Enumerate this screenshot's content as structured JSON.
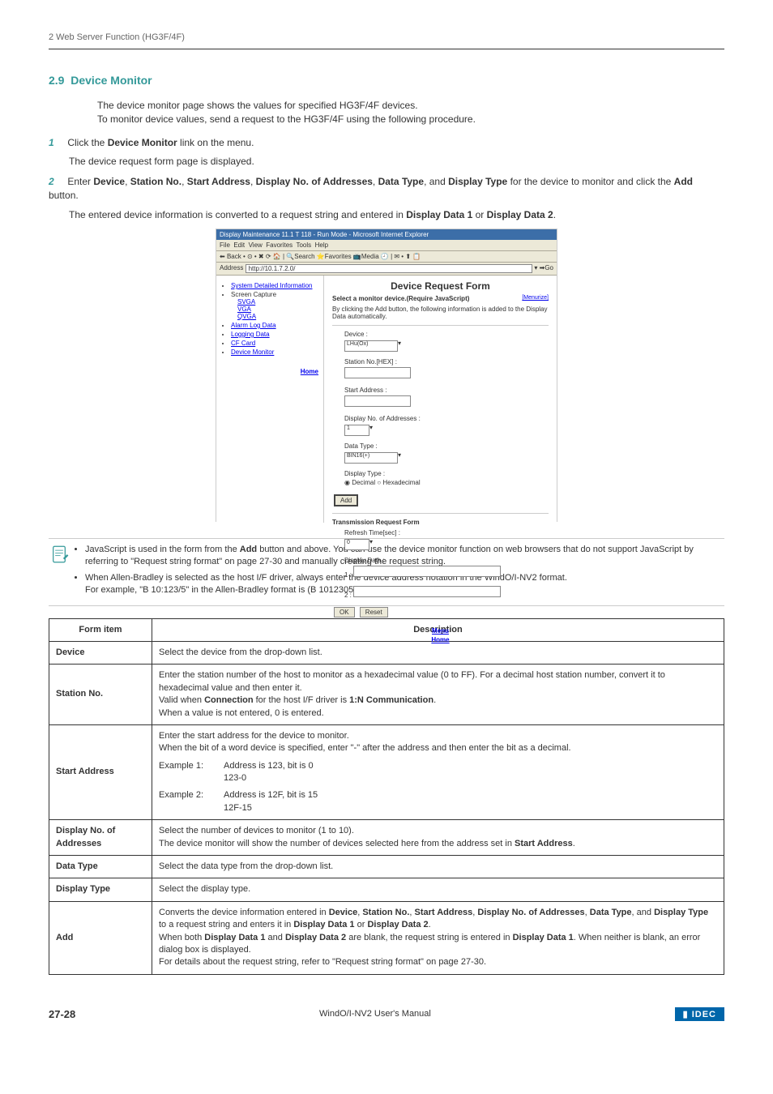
{
  "breadcrumb": "2 Web Server Function (HG3F/4F)",
  "section_num": "2.9",
  "section_title": "Device Monitor",
  "intro": "The device monitor page shows the values for specified HG3F/4F devices.\nTo monitor device values, send a request to the HG3F/4F using the following procedure.",
  "step1_num": "1",
  "step1_pre": "Click the ",
  "step1_bold": "Device Monitor",
  "step1_post": " link on the menu.",
  "step1_sub": "The device request form page is displayed.",
  "step2_num": "2",
  "step2_pre": "Enter ",
  "step2_b1": "Device",
  "step2_s1": ", ",
  "step2_b2": "Station No.",
  "step2_s2": ", ",
  "step2_b3": "Start Address",
  "step2_s3": ", ",
  "step2_b4": "Display No. of Addresses",
  "step2_s4": ", ",
  "step2_b5": "Data Type",
  "step2_s5": ", and ",
  "step2_b6": "Display Type",
  "step2_s6": " for the device to monitor and click the ",
  "step2_b7": "Add",
  "step2_s7": " button.",
  "step2_sub_pre": "The entered device information is converted to a request string and entered in ",
  "step2_sub_b1": "Display Data 1",
  "step2_sub_s1": " or ",
  "step2_sub_b2": "Display Data 2",
  "step2_sub_s2": ".",
  "screenshot": {
    "titlebar": "Display Maintenance 11.1 T 118 - Run Mode - Microsoft Internet Explorer",
    "menu_file": "File",
    "menu_edit": "Edit",
    "menu_view": "View",
    "menu_fav": "Favorites",
    "menu_tools": "Tools",
    "menu_help": "Help",
    "tb_back": "Back",
    "tb_search": "Search",
    "tb_fav": "Favorites",
    "tb_media": "Media",
    "addr_label": "Address",
    "addr_value": "http://10.1.7.2.0/",
    "addr_go": "Go",
    "sb_sysinfo": "System Detailed Information",
    "sb_screen": "Screen Capture",
    "sb_svga": "SVGA",
    "sb_vga": "VGA",
    "sb_qvga": "QVGA",
    "sb_alarm": "Alarm Log Data",
    "sb_logging": "Logging Data",
    "sb_cf": "CF Card",
    "sb_devmon": "Device Monitor",
    "sb_home": "Home",
    "main_heading": "Device Request Form",
    "main_menize": "[Menurize]",
    "main_select": "Select a monitor device.(Require JavaScript)",
    "main_desc": "By clicking the Add button, the following information is added to the Display Data automatically.",
    "fld_device": "Device :",
    "fld_device_val": "LHu(Ox)",
    "fld_station": "Station No.[HEX] :",
    "fld_start": "Start Address :",
    "fld_dispno": "Display No. of Addresses :",
    "fld_dispno_val": "1",
    "fld_datatype": "Data Type :",
    "fld_datatype_val": "BIN16(+)",
    "fld_disptype": "Display Type :",
    "fld_disptype_dec": "Decimal",
    "fld_disptype_hex": "Hexadecimal",
    "btn_add": "Add",
    "trans_heading": "Transmission Request Form",
    "fld_refresh": "Refresh Time[sec] :",
    "fld_refresh_val": "0",
    "fld_dispdata": "Display Data :",
    "fld_dd1": "1 :",
    "fld_dd2": "2 :",
    "btn_ok": "OK",
    "btn_reset": "Reset",
    "ftr_menu": "Menu",
    "ftr_home": "Home"
  },
  "note1_pre": "JavaScript is used in the form from the ",
  "note1_b1": "Add",
  "note1_post": " button and above. You can use the device monitor function on web browsers that do not support JavaScript by referring to \"Request string format\" on page 27-30 and manually creating the request string.",
  "note2": "When Allen-Bradley is selected as the host I/F driver, always enter the device address notation in the WindO/I-NV2 format.",
  "note2_sub": "For example, \"B 10:123/5\" in the Allen-Bradley format is (B 1012305) in the WindO/I-NV2 format.",
  "table": {
    "th_form": "Form item",
    "th_desc": "Description",
    "r1_label": "Device",
    "r1_desc": "Select the device from the drop-down list.",
    "r2_label": "Station No.",
    "r2_desc_l1": "Enter the station number of the host to monitor as a hexadecimal value (0 to FF). For a decimal host station number, convert it to hexadecimal value and then enter it.",
    "r2_desc_l2a": "Valid when ",
    "r2_desc_l2b1": "Connection",
    "r2_desc_l2c": " for the host I/F driver is ",
    "r2_desc_l2b2": "1:N Communication",
    "r2_desc_l2d": ".",
    "r2_desc_l3": "When a value is not entered, 0 is entered.",
    "r3_label": "Start Address",
    "r3_desc_l1": "Enter the start address for the device to monitor.",
    "r3_desc_l2": "When the bit of a word device is specified, enter \"-\" after the address and then enter the bit as a decimal.",
    "r3_ex1_label": "Example 1:",
    "r3_ex1_l1": "Address is 123, bit is 0",
    "r3_ex1_l2": "123-0",
    "r3_ex2_label": "Example 2:",
    "r3_ex2_l1": "Address is 12F, bit is 15",
    "r3_ex2_l2": "12F-15",
    "r4_label": "Display No. of Addresses",
    "r4_desc_l1": "Select the number of devices to monitor (1 to 10).",
    "r4_desc_l2a": "The device monitor will show the number of devices selected here from the address set in ",
    "r4_desc_l2b": "Start Address",
    "r4_desc_l2c": ".",
    "r5_label": "Data Type",
    "r5_desc": "Select the data type from the drop-down list.",
    "r6_label": "Display Type",
    "r6_desc": "Select the display type.",
    "r7_label": "Add",
    "r7_l1a": "Converts the device information entered in ",
    "r7_l1b1": "Device",
    "r7_l1s1": ", ",
    "r7_l1b2": "Station No.",
    "r7_l1s2": ", ",
    "r7_l1b3": "Start Address",
    "r7_l1s3": ", ",
    "r7_l1b4": "Display No. of Addresses",
    "r7_l1s4": ", ",
    "r7_l1b5": "Data Type",
    "r7_l1s5": ", and ",
    "r7_l1b6": "Display Type",
    "r7_l1s6": " to a request string and enters it in ",
    "r7_l1b7": "Display Data 1",
    "r7_l1s7": " or ",
    "r7_l1b8": "Display Data 2",
    "r7_l1s8": ".",
    "r7_l2a": "When both ",
    "r7_l2b1": "Display Data 1",
    "r7_l2s1": " and ",
    "r7_l2b2": "Display Data 2",
    "r7_l2s2": " are blank, the request string is entered in ",
    "r7_l2b3": "Display Data 1",
    "r7_l2s3": ". When neither is blank, an error dialog box is displayed.",
    "r7_l3": "For details about the request string, refer to \"Request string format\" on page 27-30."
  },
  "footer": {
    "page": "27-28",
    "center": "WindO/I-NV2 User's Manual",
    "logo": "IDEC"
  }
}
